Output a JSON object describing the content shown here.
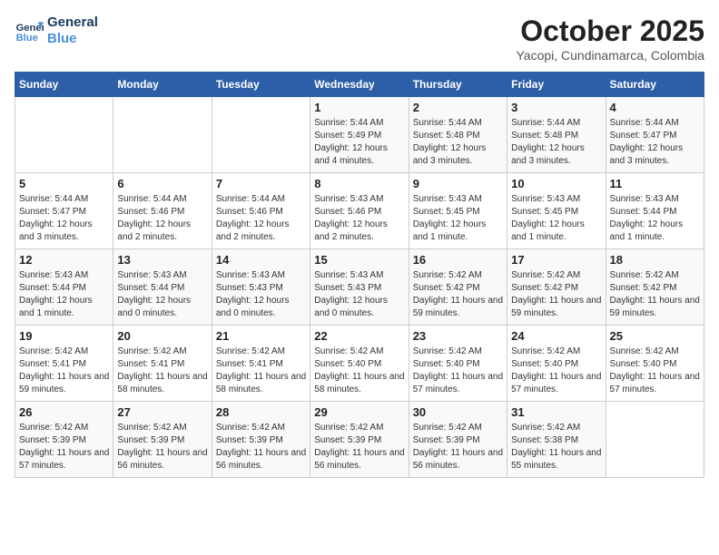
{
  "header": {
    "logo_line1": "General",
    "logo_line2": "Blue",
    "month": "October 2025",
    "location": "Yacopi, Cundinamarca, Colombia"
  },
  "weekdays": [
    "Sunday",
    "Monday",
    "Tuesday",
    "Wednesday",
    "Thursday",
    "Friday",
    "Saturday"
  ],
  "weeks": [
    [
      {
        "day": "",
        "sunrise": "",
        "sunset": "",
        "daylight": ""
      },
      {
        "day": "",
        "sunrise": "",
        "sunset": "",
        "daylight": ""
      },
      {
        "day": "",
        "sunrise": "",
        "sunset": "",
        "daylight": ""
      },
      {
        "day": "1",
        "sunrise": "Sunrise: 5:44 AM",
        "sunset": "Sunset: 5:49 PM",
        "daylight": "Daylight: 12 hours and 4 minutes."
      },
      {
        "day": "2",
        "sunrise": "Sunrise: 5:44 AM",
        "sunset": "Sunset: 5:48 PM",
        "daylight": "Daylight: 12 hours and 3 minutes."
      },
      {
        "day": "3",
        "sunrise": "Sunrise: 5:44 AM",
        "sunset": "Sunset: 5:48 PM",
        "daylight": "Daylight: 12 hours and 3 minutes."
      },
      {
        "day": "4",
        "sunrise": "Sunrise: 5:44 AM",
        "sunset": "Sunset: 5:47 PM",
        "daylight": "Daylight: 12 hours and 3 minutes."
      }
    ],
    [
      {
        "day": "5",
        "sunrise": "Sunrise: 5:44 AM",
        "sunset": "Sunset: 5:47 PM",
        "daylight": "Daylight: 12 hours and 3 minutes."
      },
      {
        "day": "6",
        "sunrise": "Sunrise: 5:44 AM",
        "sunset": "Sunset: 5:46 PM",
        "daylight": "Daylight: 12 hours and 2 minutes."
      },
      {
        "day": "7",
        "sunrise": "Sunrise: 5:44 AM",
        "sunset": "Sunset: 5:46 PM",
        "daylight": "Daylight: 12 hours and 2 minutes."
      },
      {
        "day": "8",
        "sunrise": "Sunrise: 5:43 AM",
        "sunset": "Sunset: 5:46 PM",
        "daylight": "Daylight: 12 hours and 2 minutes."
      },
      {
        "day": "9",
        "sunrise": "Sunrise: 5:43 AM",
        "sunset": "Sunset: 5:45 PM",
        "daylight": "Daylight: 12 hours and 1 minute."
      },
      {
        "day": "10",
        "sunrise": "Sunrise: 5:43 AM",
        "sunset": "Sunset: 5:45 PM",
        "daylight": "Daylight: 12 hours and 1 minute."
      },
      {
        "day": "11",
        "sunrise": "Sunrise: 5:43 AM",
        "sunset": "Sunset: 5:44 PM",
        "daylight": "Daylight: 12 hours and 1 minute."
      }
    ],
    [
      {
        "day": "12",
        "sunrise": "Sunrise: 5:43 AM",
        "sunset": "Sunset: 5:44 PM",
        "daylight": "Daylight: 12 hours and 1 minute."
      },
      {
        "day": "13",
        "sunrise": "Sunrise: 5:43 AM",
        "sunset": "Sunset: 5:44 PM",
        "daylight": "Daylight: 12 hours and 0 minutes."
      },
      {
        "day": "14",
        "sunrise": "Sunrise: 5:43 AM",
        "sunset": "Sunset: 5:43 PM",
        "daylight": "Daylight: 12 hours and 0 minutes."
      },
      {
        "day": "15",
        "sunrise": "Sunrise: 5:43 AM",
        "sunset": "Sunset: 5:43 PM",
        "daylight": "Daylight: 12 hours and 0 minutes."
      },
      {
        "day": "16",
        "sunrise": "Sunrise: 5:42 AM",
        "sunset": "Sunset: 5:42 PM",
        "daylight": "Daylight: 11 hours and 59 minutes."
      },
      {
        "day": "17",
        "sunrise": "Sunrise: 5:42 AM",
        "sunset": "Sunset: 5:42 PM",
        "daylight": "Daylight: 11 hours and 59 minutes."
      },
      {
        "day": "18",
        "sunrise": "Sunrise: 5:42 AM",
        "sunset": "Sunset: 5:42 PM",
        "daylight": "Daylight: 11 hours and 59 minutes."
      }
    ],
    [
      {
        "day": "19",
        "sunrise": "Sunrise: 5:42 AM",
        "sunset": "Sunset: 5:41 PM",
        "daylight": "Daylight: 11 hours and 59 minutes."
      },
      {
        "day": "20",
        "sunrise": "Sunrise: 5:42 AM",
        "sunset": "Sunset: 5:41 PM",
        "daylight": "Daylight: 11 hours and 58 minutes."
      },
      {
        "day": "21",
        "sunrise": "Sunrise: 5:42 AM",
        "sunset": "Sunset: 5:41 PM",
        "daylight": "Daylight: 11 hours and 58 minutes."
      },
      {
        "day": "22",
        "sunrise": "Sunrise: 5:42 AM",
        "sunset": "Sunset: 5:40 PM",
        "daylight": "Daylight: 11 hours and 58 minutes."
      },
      {
        "day": "23",
        "sunrise": "Sunrise: 5:42 AM",
        "sunset": "Sunset: 5:40 PM",
        "daylight": "Daylight: 11 hours and 57 minutes."
      },
      {
        "day": "24",
        "sunrise": "Sunrise: 5:42 AM",
        "sunset": "Sunset: 5:40 PM",
        "daylight": "Daylight: 11 hours and 57 minutes."
      },
      {
        "day": "25",
        "sunrise": "Sunrise: 5:42 AM",
        "sunset": "Sunset: 5:40 PM",
        "daylight": "Daylight: 11 hours and 57 minutes."
      }
    ],
    [
      {
        "day": "26",
        "sunrise": "Sunrise: 5:42 AM",
        "sunset": "Sunset: 5:39 PM",
        "daylight": "Daylight: 11 hours and 57 minutes."
      },
      {
        "day": "27",
        "sunrise": "Sunrise: 5:42 AM",
        "sunset": "Sunset: 5:39 PM",
        "daylight": "Daylight: 11 hours and 56 minutes."
      },
      {
        "day": "28",
        "sunrise": "Sunrise: 5:42 AM",
        "sunset": "Sunset: 5:39 PM",
        "daylight": "Daylight: 11 hours and 56 minutes."
      },
      {
        "day": "29",
        "sunrise": "Sunrise: 5:42 AM",
        "sunset": "Sunset: 5:39 PM",
        "daylight": "Daylight: 11 hours and 56 minutes."
      },
      {
        "day": "30",
        "sunrise": "Sunrise: 5:42 AM",
        "sunset": "Sunset: 5:39 PM",
        "daylight": "Daylight: 11 hours and 56 minutes."
      },
      {
        "day": "31",
        "sunrise": "Sunrise: 5:42 AM",
        "sunset": "Sunset: 5:38 PM",
        "daylight": "Daylight: 11 hours and 55 minutes."
      },
      {
        "day": "",
        "sunrise": "",
        "sunset": "",
        "daylight": ""
      }
    ]
  ]
}
